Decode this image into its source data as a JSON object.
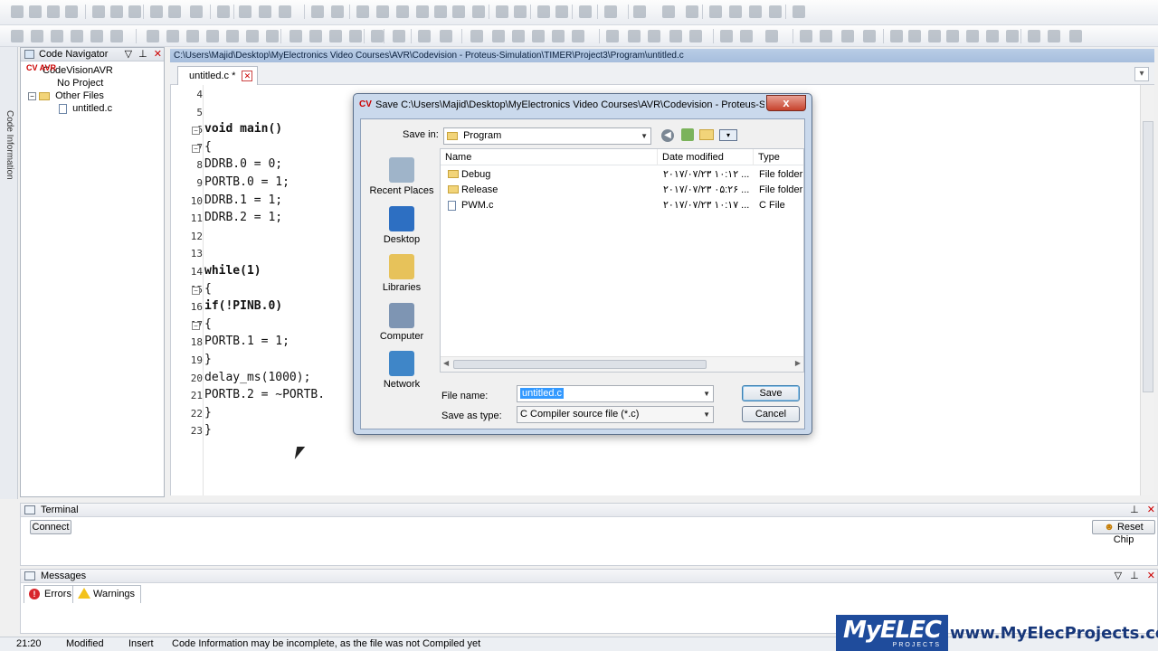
{
  "editor": {
    "path": "C:\\Users\\Majid\\Desktop\\MyElectronics Video Courses\\AVR\\Codevision - Proteus-Simulation\\TIMER\\Project3\\Program\\untitled.c",
    "tab_label": "untitled.c *",
    "lines": [
      {
        "num": "4",
        "code": ""
      },
      {
        "num": "5",
        "code": ""
      },
      {
        "num": "6",
        "code": "void main()"
      },
      {
        "num": "7",
        "code": "{"
      },
      {
        "num": "8",
        "code": "DDRB.0 = 0;"
      },
      {
        "num": "9",
        "code": "PORTB.0 = 1;"
      },
      {
        "num": "10",
        "code": "DDRB.1 = 1;"
      },
      {
        "num": "11",
        "code": "DDRB.2 = 1;"
      },
      {
        "num": "12",
        "code": ""
      },
      {
        "num": "13",
        "code": ""
      },
      {
        "num": "14",
        "code": "while(1)"
      },
      {
        "num": "15",
        "code": "{"
      },
      {
        "num": "16",
        "code": "if(!PINB.0)"
      },
      {
        "num": "17",
        "code": "{"
      },
      {
        "num": "18",
        "code": "PORTB.1 = 1;"
      },
      {
        "num": "19",
        "code": "}"
      },
      {
        "num": "20",
        "code": "delay_ms(1000);"
      },
      {
        "num": "21",
        "code": "PORTB.2 = ~PORTB."
      },
      {
        "num": "22",
        "code": "}"
      },
      {
        "num": "23",
        "code": "}"
      }
    ]
  },
  "navigator": {
    "title": "Code Navigator",
    "root": "CodeVisionAVR",
    "logo_text": "CV AVR",
    "no_project": "No Project",
    "other_files": "Other Files",
    "file": "untitled.c"
  },
  "sidetab": {
    "label": "Code Information"
  },
  "terminal": {
    "title": "Terminal",
    "connect": "Connect",
    "reset_chip": "Reset Chip"
  },
  "messages": {
    "title": "Messages",
    "errors_tab": "Errors",
    "warnings_tab": "Warnings"
  },
  "status": {
    "position": "21:20",
    "modified": "Modified",
    "mode": "Insert",
    "info": "Code Information may be incomplete, as the file was not Compiled yet"
  },
  "dialog": {
    "title": "Save C:\\Users\\Majid\\Desktop\\MyElectronics Video Courses\\AVR\\Codevision - Proteus-Si...",
    "icon_text": "CV",
    "close_label": "x",
    "save_in_label": "Save in:",
    "save_in_value": "Program",
    "places": [
      "Recent Places",
      "Desktop",
      "Libraries",
      "Computer",
      "Network"
    ],
    "columns": [
      "Name",
      "Date modified",
      "Type"
    ],
    "files": [
      {
        "name": "Debug",
        "date": "۲۰۱۷/۰۷/۲۳ ۱۰:۱۲ ...",
        "type": "File folder"
      },
      {
        "name": "Release",
        "date": "۲۰۱۷/۰۷/۲۳ ۰۵:۲۶ ...",
        "type": "File folder"
      },
      {
        "name": "PWM.c",
        "date": "۲۰۱۷/۰۷/۲۳ ۱۰:۱۷ ...",
        "type": "C File"
      }
    ],
    "file_name_label": "File name:",
    "file_name_value": "untitled.c",
    "save_as_label": "Save as type:",
    "save_as_value": "C Compiler source file (*.c)",
    "save_button": "Save",
    "cancel_button": "Cancel"
  },
  "watermark": {
    "logo": "MyELEC",
    "logo_sub": "PROJECTS",
    "url": "www.MyElecProjects.com"
  },
  "colors": {
    "path_bar": "#a6bedd",
    "dialog_frame": "#cad9ec",
    "selection": "#3399ff",
    "close_red": "#c7422c",
    "watermark_blue": "#1f4c9c"
  }
}
